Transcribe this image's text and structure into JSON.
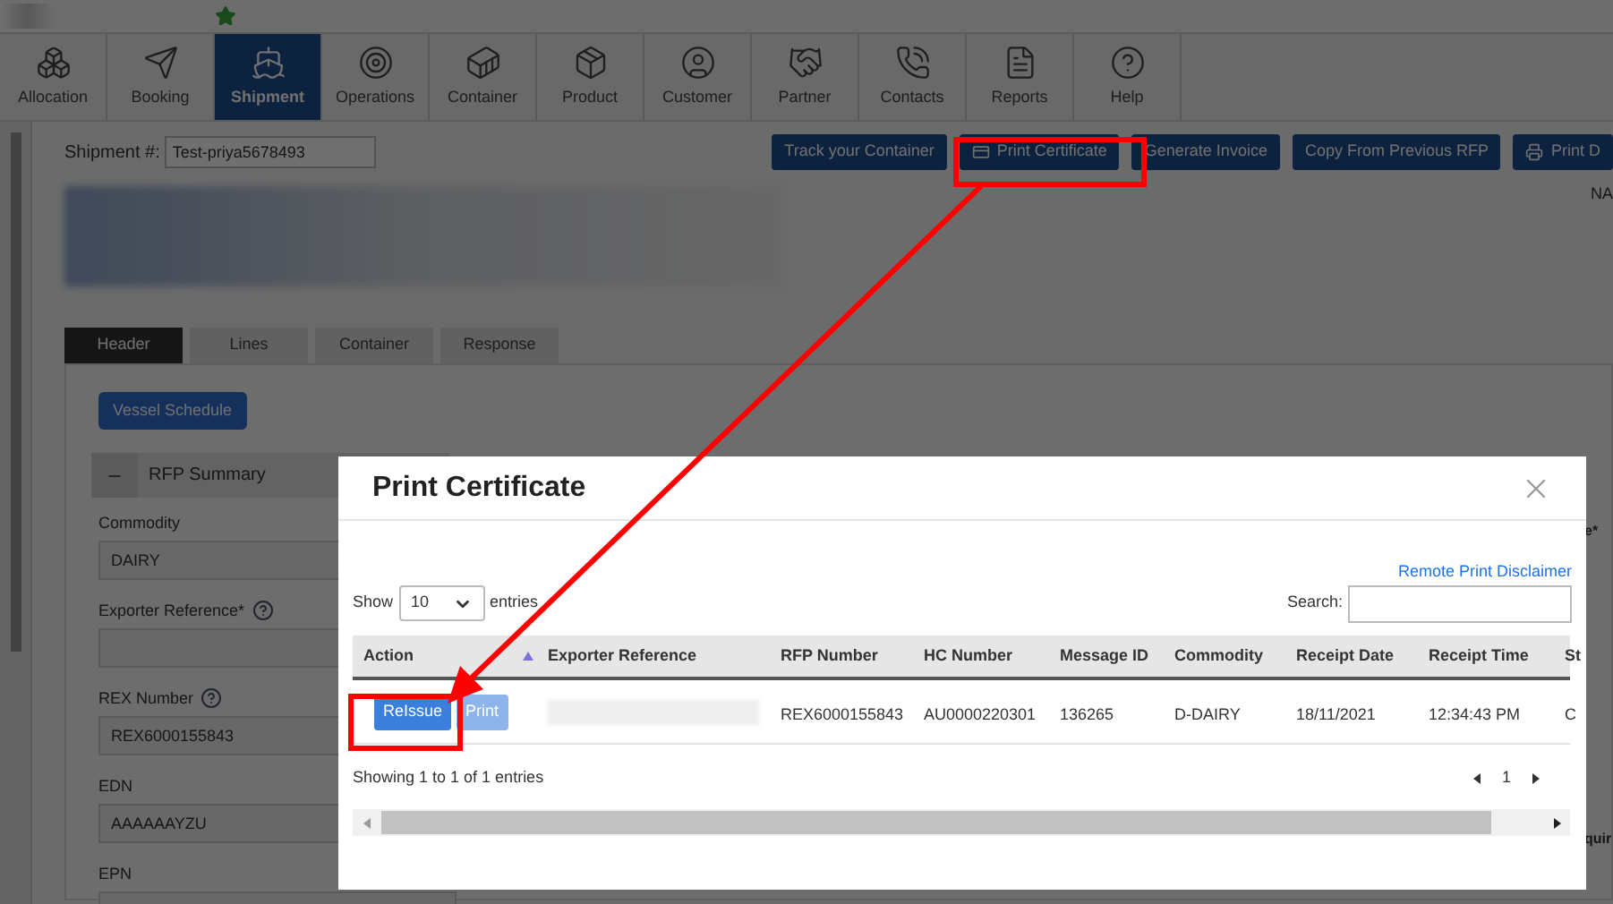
{
  "nav": [
    {
      "label": "Allocation",
      "selected": false
    },
    {
      "label": "Booking",
      "selected": false
    },
    {
      "label": "Shipment",
      "selected": true
    },
    {
      "label": "Operations",
      "selected": false
    },
    {
      "label": "Container",
      "selected": false
    },
    {
      "label": "Product",
      "selected": false
    },
    {
      "label": "Customer",
      "selected": false
    },
    {
      "label": "Partner",
      "selected": false
    },
    {
      "label": "Contacts",
      "selected": false
    },
    {
      "label": "Reports",
      "selected": false
    },
    {
      "label": "Help",
      "selected": false
    }
  ],
  "shipment": {
    "label": "Shipment #:",
    "value": "Test-priya5678493"
  },
  "actions": [
    {
      "label": "Track your Container",
      "kind": "plain"
    },
    {
      "label": "Print Certificate",
      "kind": "card"
    },
    {
      "label": "Generate Invoice",
      "kind": "plain"
    },
    {
      "label": "Copy From Previous RFP",
      "kind": "plain"
    },
    {
      "label": "Print D",
      "kind": "printer"
    }
  ],
  "corner_label": "NA",
  "detail_tabs": [
    {
      "label": "Header",
      "selected": true
    },
    {
      "label": "Lines",
      "selected": false
    },
    {
      "label": "Container",
      "selected": false
    },
    {
      "label": "Response",
      "selected": false
    }
  ],
  "vessel_button": "Vessel Schedule",
  "section": {
    "title": "RFP Summary",
    "expanded": true
  },
  "fields": [
    {
      "label": "Commodity",
      "help": false,
      "value": "DAIRY"
    },
    {
      "label": "Exporter Reference*",
      "help": true
    },
    {
      "label": "REX Number",
      "help": true,
      "value": "REX6000155843"
    },
    {
      "label": "EDN",
      "help": false,
      "value": "AAAAAAYZU"
    },
    {
      "label": "EPN",
      "help": false
    }
  ],
  "right_fragments": [
    "e*",
    "quir"
  ],
  "modal": {
    "title": "Print Certificate",
    "disclaimer_link": "Remote Print Disclaimer",
    "show_label": "Show",
    "page_length": "10",
    "entries_label": "entries",
    "search_label": "Search:",
    "columns": [
      {
        "label": "Action",
        "sorted": true
      },
      {
        "label": "Exporter Reference",
        "sorted": false
      },
      {
        "label": "RFP Number",
        "sorted": false
      },
      {
        "label": "HC Number",
        "sorted": false
      },
      {
        "label": "Message ID",
        "sorted": false
      },
      {
        "label": "Commodity",
        "sorted": false
      },
      {
        "label": "Receipt Date",
        "sorted": false
      },
      {
        "label": "Receipt Time",
        "sorted": false
      },
      {
        "label": "St",
        "sorted": false
      }
    ],
    "rows": [
      {
        "buttons": [
          {
            "label": "ReIssue",
            "disabled": false
          },
          {
            "label": "Print",
            "disabled": true
          }
        ],
        "cells": [
          "",
          "",
          "REX6000155843",
          "AU0000220301",
          "136265",
          "D-DAIRY",
          "18/11/2021",
          "12:34:43 PM",
          "C"
        ]
      }
    ],
    "info": "Showing 1 to 1 of 1 entries",
    "page": "1"
  },
  "annotation": {
    "arrow": true,
    "color": "#ff0000"
  }
}
